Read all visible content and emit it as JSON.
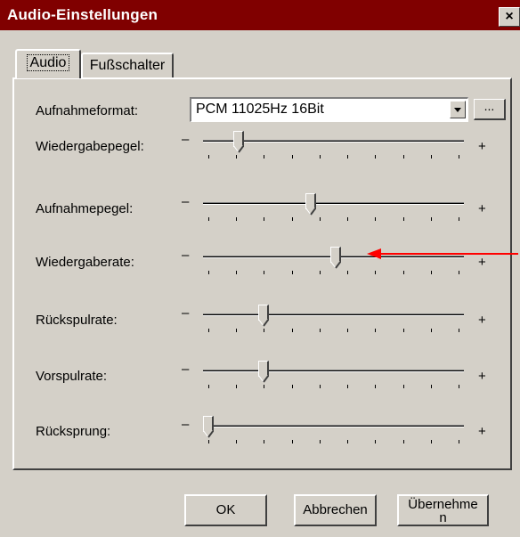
{
  "window": {
    "title": "Audio-Einstellungen",
    "close_label": "×"
  },
  "tabs": [
    {
      "label": "Audio",
      "active": true
    },
    {
      "label": "Fußschalter",
      "active": false
    }
  ],
  "format": {
    "label": "Aufnahmeformat:",
    "value": "PCM 11025Hz 16Bit",
    "more_label": "..."
  },
  "slider_common": {
    "minus": "–",
    "plus": "+",
    "tick_count": 10
  },
  "sliders": [
    {
      "label": "Wiedergabepegel:",
      "value": 0.12
    },
    {
      "label": "Aufnahmepegel:",
      "value": 0.41
    },
    {
      "label": "Wiedergaberate:",
      "value": 0.51
    },
    {
      "label": "Rückspulrate:",
      "value": 0.22
    },
    {
      "label": "Vorspulrate:",
      "value": 0.22
    },
    {
      "label": "Rücksprung:",
      "value": 0.0
    }
  ],
  "buttons": {
    "ok": "OK",
    "cancel": "Abbrechen",
    "apply": "Übernehme\nn"
  },
  "colors": {
    "titlebar": "#800000",
    "face": "#d4d0c8",
    "annotation_arrow": "#ff0000"
  }
}
